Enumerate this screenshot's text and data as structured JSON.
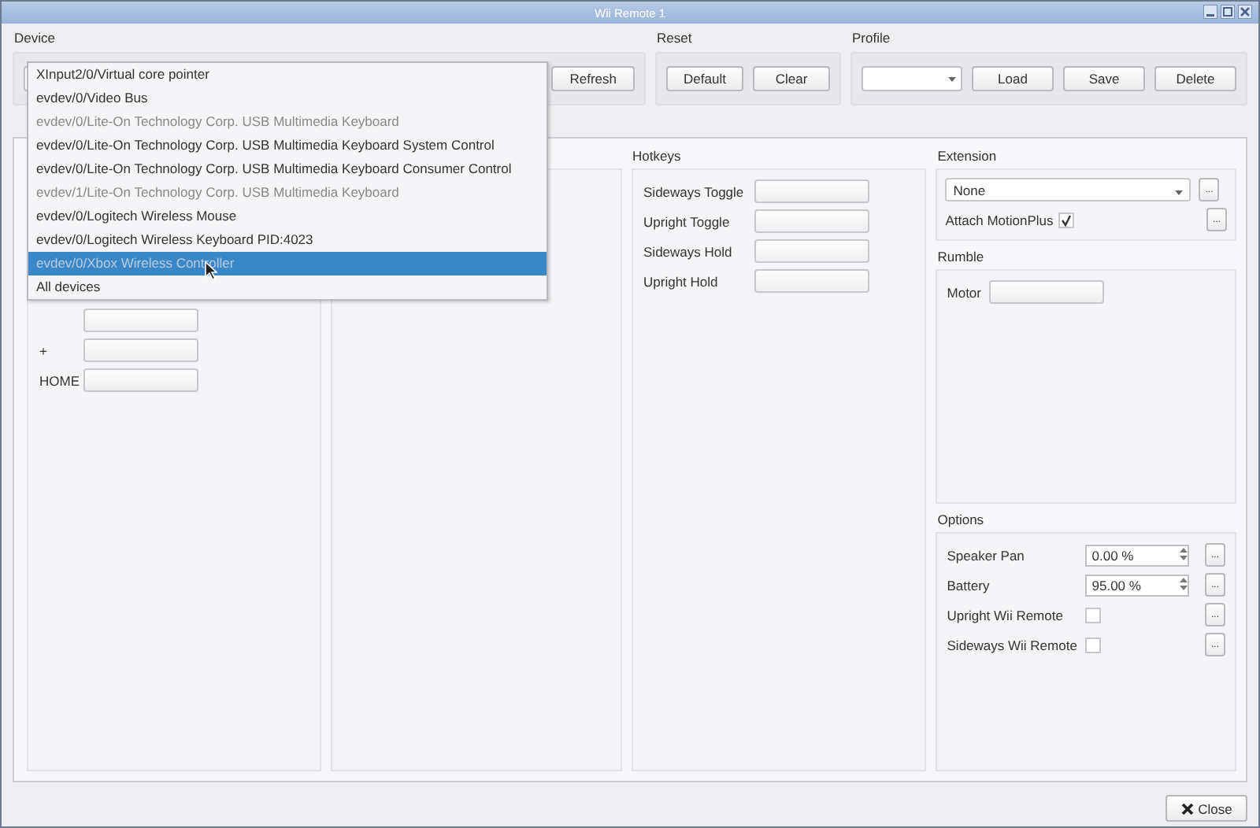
{
  "window": {
    "title": "Wii Remote 1"
  },
  "device": {
    "label": "Device",
    "refresh_button": "Refresh",
    "dropdown": {
      "items": [
        {
          "label": "XInput2/0/Virtual core pointer",
          "disabled": false,
          "selected": false
        },
        {
          "label": "evdev/0/Video Bus",
          "disabled": false,
          "selected": false
        },
        {
          "label": "evdev/0/Lite-On Technology Corp. USB Multimedia Keyboard",
          "disabled": true,
          "selected": false
        },
        {
          "label": "evdev/0/Lite-On Technology Corp. USB Multimedia Keyboard System Control",
          "disabled": false,
          "selected": false
        },
        {
          "label": "evdev/0/Lite-On Technology Corp. USB Multimedia Keyboard Consumer Control",
          "disabled": false,
          "selected": false
        },
        {
          "label": "evdev/1/Lite-On Technology Corp. USB Multimedia Keyboard",
          "disabled": true,
          "selected": false
        },
        {
          "label": "evdev/0/Logitech Wireless Mouse",
          "disabled": false,
          "selected": false
        },
        {
          "label": "evdev/0/Logitech Wireless Keyboard PID:4023",
          "disabled": false,
          "selected": false
        },
        {
          "label": "evdev/0/Xbox Wireless Controller",
          "disabled": true,
          "selected": true
        },
        {
          "label": "All devices",
          "disabled": false,
          "selected": false
        }
      ]
    }
  },
  "reset": {
    "label": "Reset",
    "buttons": [
      "Default",
      "Clear"
    ]
  },
  "profile": {
    "label": "Profile",
    "buttons": [
      "Load",
      "Save",
      "Delete"
    ]
  },
  "buttons_panel": {
    "rows": [
      {
        "label": "+"
      },
      {
        "label": "HOME"
      }
    ]
  },
  "hotkeys": {
    "label": "Hotkeys",
    "rows": [
      {
        "label": "Sideways Toggle"
      },
      {
        "label": "Upright Toggle"
      },
      {
        "label": "Sideways Hold"
      },
      {
        "label": "Upright Hold"
      }
    ]
  },
  "extension": {
    "label": "Extension",
    "select_value": "None",
    "more": "...",
    "motionplus": {
      "label": "Attach MotionPlus",
      "checked": true,
      "more": "..."
    }
  },
  "rumble": {
    "label": "Rumble",
    "rows": [
      {
        "label": "Motor"
      }
    ]
  },
  "options": {
    "label": "Options",
    "rows": [
      {
        "kind": "spin",
        "label": "Speaker Pan",
        "value": "0.00 %",
        "more": "..."
      },
      {
        "kind": "spin",
        "label": "Battery",
        "value": "95.00 %",
        "more": "..."
      },
      {
        "kind": "check",
        "label": "Upright Wii Remote",
        "checked": false,
        "more": "..."
      },
      {
        "kind": "check",
        "label": "Sideways Wii Remote",
        "checked": false,
        "more": "..."
      }
    ]
  },
  "close_button": "Close"
}
